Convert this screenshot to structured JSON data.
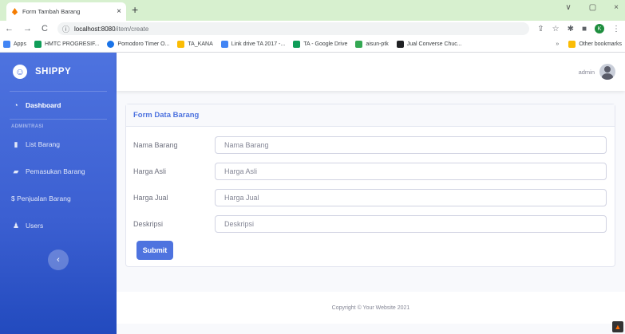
{
  "browser": {
    "tab_title": "Form Tambah Barang",
    "tab_close": "×",
    "new_tab": "+",
    "url_host": "localhost:8080",
    "url_path": "/item/create",
    "window_controls": [
      "∨",
      "▢",
      "×"
    ],
    "profile_initial": "K",
    "bookmarks": [
      {
        "label": "Apps",
        "color": "#4285f4"
      },
      {
        "label": "HMTC PROGRESIF...",
        "color": "#0f9d58"
      },
      {
        "label": "Pomodoro Timer O...",
        "color": "#1a73e8"
      },
      {
        "label": "TA_KANA",
        "color": "#fbbc04"
      },
      {
        "label": "Link drive TA 2017 -...",
        "color": "#4285f4"
      },
      {
        "label": "TA - Google Drive",
        "color": "#0f9d58"
      },
      {
        "label": "aisun-ptk",
        "color": "#34a853"
      },
      {
        "label": "Jual Converse Chuc...",
        "color": "#202124"
      }
    ],
    "bookmarks_more": "»",
    "other_bookmarks": "Other bookmarks"
  },
  "sidebar": {
    "brand": "SHIPPY",
    "brand_icon": "☺",
    "dashboard": "Dashboard",
    "heading": "ADMINTRASI",
    "items": [
      {
        "label": "List Barang",
        "icon": "clipboard-icon"
      },
      {
        "label": "Pemasukan Barang",
        "icon": "truck-icon"
      },
      {
        "label": "$ Penjualan Barang",
        "icon": "dollar-icon"
      },
      {
        "label": "Users",
        "icon": "users-icon"
      }
    ],
    "toggle": "‹"
  },
  "topbar": {
    "user_name": "admin"
  },
  "form": {
    "title": "Form Data Barang",
    "fields": [
      {
        "label": "Nama Barang",
        "placeholder": "Nama Barang"
      },
      {
        "label": "Harga Asli",
        "placeholder": "Harga Asli"
      },
      {
        "label": "Harga Jual",
        "placeholder": "Harga Jual"
      },
      {
        "label": "Deskripsi",
        "placeholder": "Deskripsi"
      }
    ],
    "submit": "Submit"
  },
  "footer": {
    "text": "Copyright © Your Website 2021"
  },
  "colors": {
    "primary": "#4e73df",
    "tabbar": "#d7f0cf"
  }
}
